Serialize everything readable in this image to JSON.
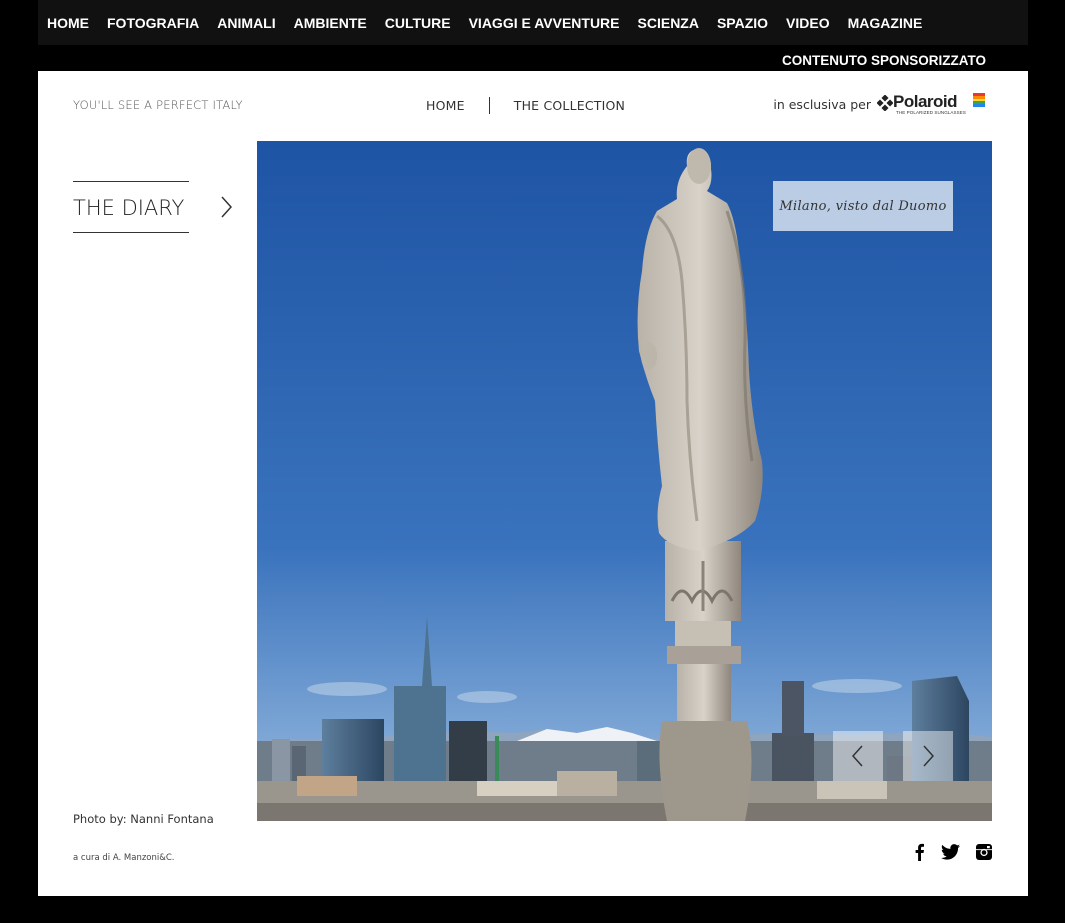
{
  "topnav": {
    "items": [
      "HOME",
      "FOTOGRAFIA",
      "ANIMALI",
      "AMBIENTE",
      "CULTURE",
      "VIAGGI E AVVENTURE",
      "SCIENZA",
      "SPAZIO",
      "VIDEO",
      "MAGAZINE"
    ],
    "sponsor_label": "CONTENUTO SPONSORIZZATO"
  },
  "header": {
    "tagline": "YOU'LL SEE A PERFECT ITALY",
    "subnav": [
      "HOME",
      "THE COLLECTION"
    ],
    "exclusive_text": "in esclusiva per",
    "logo_word": "Polaroid",
    "logo_sub": "THE POLARIZED SUNGLASSES"
  },
  "diary": {
    "label": "THE DIARY",
    "arrow_icon": "chevron-right-icon"
  },
  "photo": {
    "caption": "Milano, visto dal Duomo",
    "prev_icon": "chevron-left-icon",
    "next_icon": "chevron-right-icon"
  },
  "footer": {
    "credit": "Photo by: Nanni Fontana",
    "curated": "a cura di A. Manzoni&C.",
    "social_icons": [
      "facebook-icon",
      "twitter-icon",
      "instagram-icon"
    ]
  },
  "colors": {
    "nav_bg": "#111111",
    "page_bg": "#000000",
    "panel_bg": "#ffffff",
    "sky_top": "#1f56a6",
    "sky_bottom": "#8fb3da"
  }
}
